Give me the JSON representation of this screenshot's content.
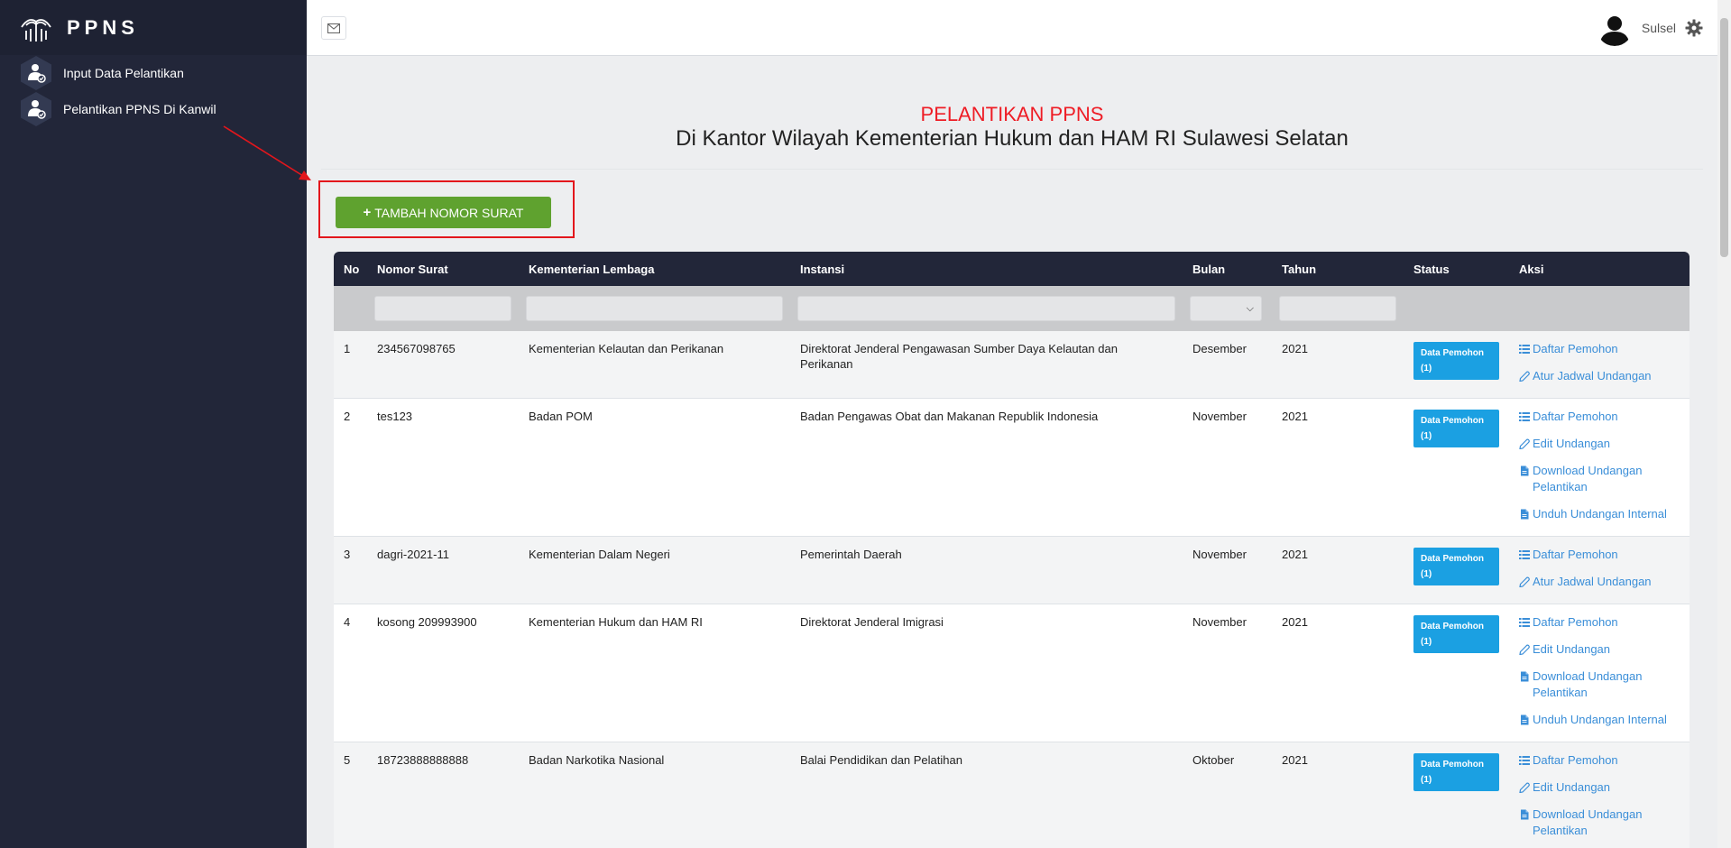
{
  "brand": {
    "name": "PPNS"
  },
  "sidebar": {
    "items": [
      {
        "label": "Input Data Pelantikan"
      },
      {
        "label": "Pelantikan PPNS Di Kanwil"
      }
    ]
  },
  "topbar": {
    "user_name": "Sulsel"
  },
  "page": {
    "title": "PELANTIKAN PPNS",
    "subtitle": "Di Kantor Wilayah Kementerian Hukum dan HAM RI Sulawesi Selatan",
    "add_button_label": "TAMBAH NOMOR SURAT"
  },
  "table": {
    "columns": [
      "No",
      "Nomor Surat",
      "Kementerian Lembaga",
      "Instansi",
      "Bulan",
      "Tahun",
      "Status",
      "Aksi"
    ],
    "rows": [
      {
        "no": "1",
        "nomor_surat": "234567098765",
        "kementerian": "Kementerian Kelautan dan Perikanan",
        "instansi": "Direktorat Jenderal Pengawasan Sumber Daya Kelautan dan Perikanan",
        "bulan": "Desember",
        "tahun": "2021",
        "status": "Data Pemohon (1)",
        "actions": [
          {
            "label": "Daftar Pemohon",
            "icon": "list-icon"
          },
          {
            "label": "Atur Jadwal Undangan",
            "icon": "edit-icon"
          }
        ]
      },
      {
        "no": "2",
        "nomor_surat": "tes123",
        "kementerian": "Badan POM",
        "instansi": "Badan Pengawas Obat dan Makanan Republik Indonesia",
        "bulan": "November",
        "tahun": "2021",
        "status": "Data Pemohon (1)",
        "actions": [
          {
            "label": "Daftar Pemohon",
            "icon": "list-icon"
          },
          {
            "label": "Edit Undangan",
            "icon": "edit-icon"
          },
          {
            "label": "Download Undangan Pelantikan",
            "icon": "file-icon"
          },
          {
            "label": "Unduh Undangan Internal",
            "icon": "file-icon"
          }
        ]
      },
      {
        "no": "3",
        "nomor_surat": "dagri-2021-11",
        "kementerian": "Kementerian Dalam Negeri",
        "instansi": "Pemerintah Daerah",
        "bulan": "November",
        "tahun": "2021",
        "status": "Data Pemohon (1)",
        "actions": [
          {
            "label": "Daftar Pemohon",
            "icon": "list-icon"
          },
          {
            "label": "Atur Jadwal Undangan",
            "icon": "edit-icon"
          }
        ]
      },
      {
        "no": "4",
        "nomor_surat": "kosong 209993900",
        "kementerian": "Kementerian Hukum dan HAM RI",
        "instansi": "Direktorat Jenderal Imigrasi",
        "bulan": "November",
        "tahun": "2021",
        "status": "Data Pemohon (1)",
        "actions": [
          {
            "label": "Daftar Pemohon",
            "icon": "list-icon"
          },
          {
            "label": "Edit Undangan",
            "icon": "edit-icon"
          },
          {
            "label": "Download Undangan Pelantikan",
            "icon": "file-icon"
          },
          {
            "label": "Unduh Undangan Internal",
            "icon": "file-icon"
          }
        ]
      },
      {
        "no": "5",
        "nomor_surat": "18723888888888",
        "kementerian": "Badan Narkotika Nasional",
        "instansi": "Balai Pendidikan dan Pelatihan",
        "bulan": "Oktober",
        "tahun": "2021",
        "status": "Data Pemohon (1)",
        "actions": [
          {
            "label": "Daftar Pemohon",
            "icon": "list-icon"
          },
          {
            "label": "Edit Undangan",
            "icon": "edit-icon"
          },
          {
            "label": "Download Undangan Pelantikan",
            "icon": "file-icon"
          }
        ]
      }
    ]
  },
  "colors": {
    "sidebar_bg": "#222639",
    "accent_green": "#5fa22f",
    "title_red": "#ee1c25",
    "badge_blue": "#1ba0e2",
    "link_blue": "#3a8ed8",
    "highlight_red": "#e3161c"
  }
}
